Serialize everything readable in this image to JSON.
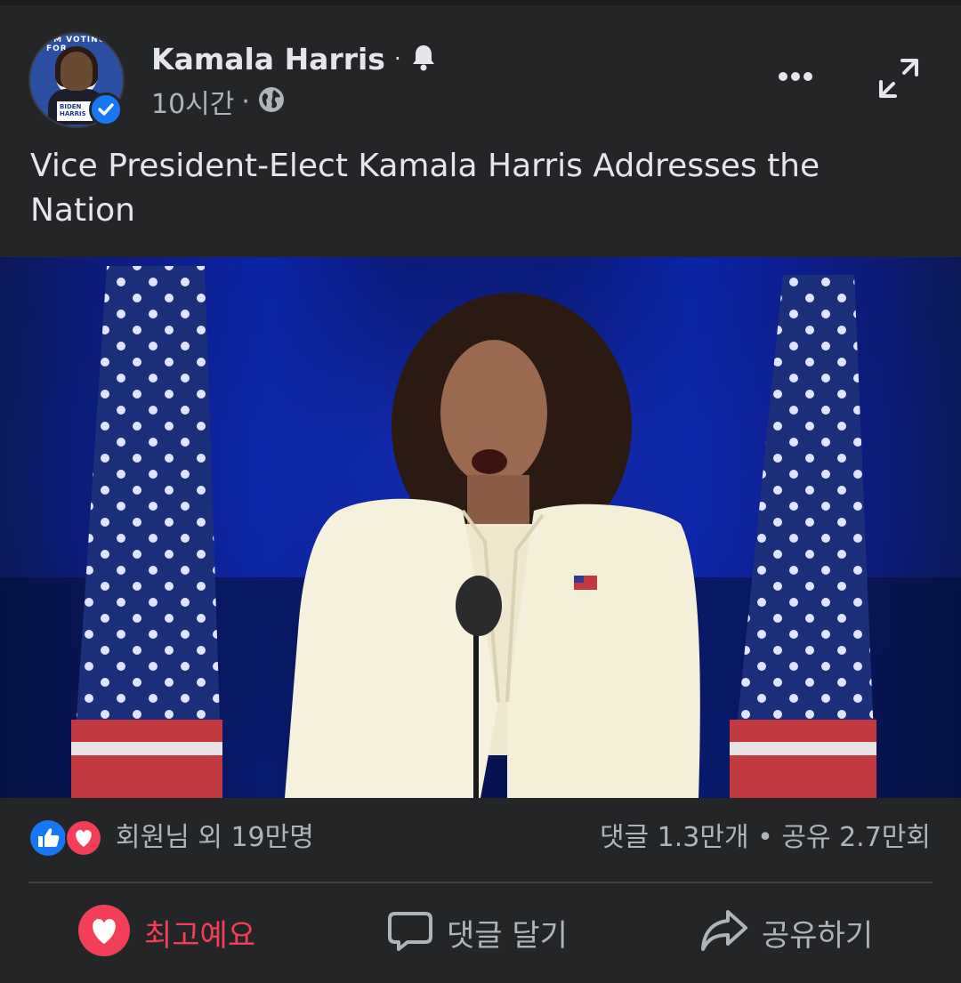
{
  "post": {
    "author": "Kamala Harris",
    "author_sep": "·",
    "time": "10시간",
    "time_sep": "·",
    "title": "Vice President-Elect Kamala Harris Addresses the Nation",
    "avatar_text": "I'M VOTING FOR",
    "avatar_badge_line1": "BIDEN",
    "avatar_badge_line2": "HARRIS"
  },
  "icons": {
    "notify": "bell-icon",
    "privacy": "globe-icon",
    "more": "more-options-icon",
    "expand": "expand-icon",
    "like": "like-icon",
    "love": "love-icon",
    "comment": "comment-icon",
    "share": "share-icon",
    "verified": "verified-icon"
  },
  "stats": {
    "reactions_text": "회원님 외 19만명",
    "counts_text": "댓글 1.3만개 • 공유 2.7만회"
  },
  "actions": {
    "love_label": "최고예요",
    "comment_label": "댓글 달기",
    "share_label": "공유하기"
  },
  "colors": {
    "background": "#242526",
    "accent_blue": "#1877f2",
    "love_red": "#f33e58",
    "text_primary": "#e4e6eb",
    "text_secondary": "#b0b3b8"
  }
}
